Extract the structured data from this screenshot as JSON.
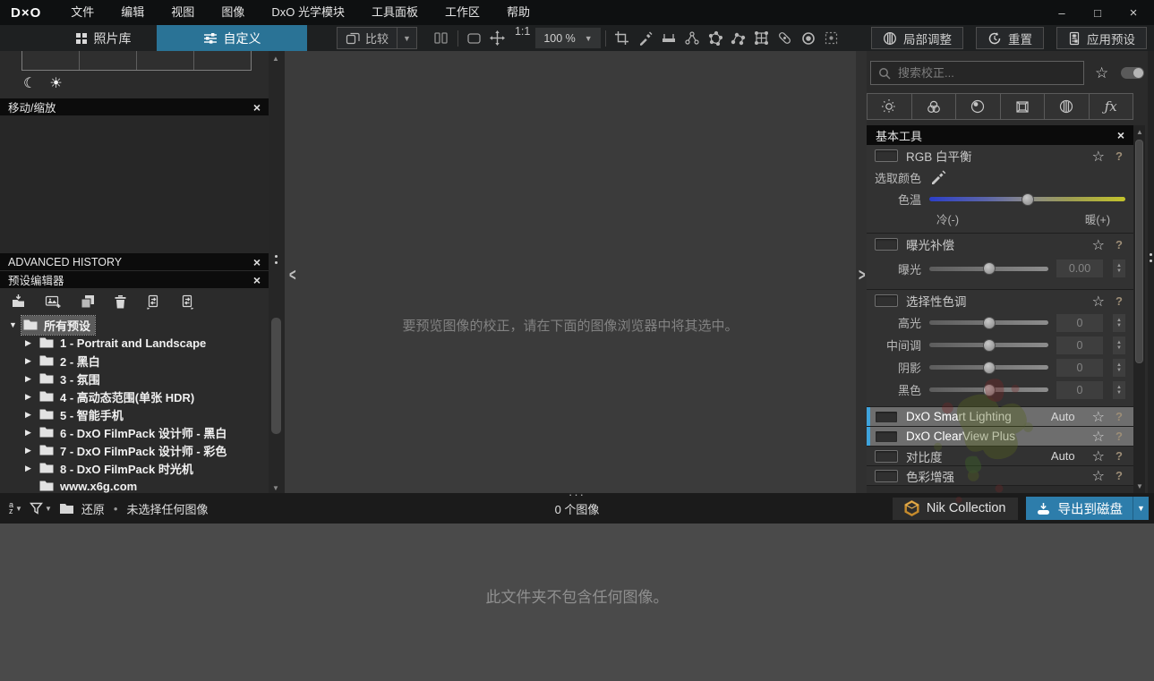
{
  "menubar": {
    "logo": "D×O",
    "items": [
      {
        "label": "文件"
      },
      {
        "label": "编辑"
      },
      {
        "label": "视图"
      },
      {
        "label": "图像"
      },
      {
        "label": "DxO 光学模块"
      },
      {
        "label": "工具面板"
      },
      {
        "label": "工作区"
      },
      {
        "label": "帮助"
      }
    ],
    "window_controls": {
      "minimize": "–",
      "maximize": "□",
      "close": "×"
    }
  },
  "toolbar": {
    "tab_photolibrary": "照片库",
    "tab_customize": "自定义",
    "compare": "比较",
    "zoom_ratio": "1:1",
    "zoom_level": "100 %",
    "local_adjustments": "局部调整",
    "reset": "重置",
    "apply_preset": "应用预设"
  },
  "left_panel": {
    "move_zoom_title": "移动/缩放",
    "history_title": "ADVANCED HISTORY",
    "preset_editor_title": "预设编辑器",
    "close_glyph": "×",
    "preset_tree": [
      {
        "arrow": "▼",
        "label": "所有预设",
        "selected": true,
        "indent": 0
      },
      {
        "arrow": "▶",
        "label": "1 - Portrait and Landscape",
        "indent": 1
      },
      {
        "arrow": "▶",
        "label": "2 - 黑白",
        "indent": 1
      },
      {
        "arrow": "▶",
        "label": "3 - 氛围",
        "indent": 1
      },
      {
        "arrow": "▶",
        "label": "4 - 高动态范围(单张 HDR)",
        "indent": 1
      },
      {
        "arrow": "▶",
        "label": "5 - 智能手机",
        "indent": 1
      },
      {
        "arrow": "▶",
        "label": "6 - DxO FilmPack 设计师 - 黑白",
        "indent": 1
      },
      {
        "arrow": "▶",
        "label": "7 - DxO FilmPack 设计师 - 彩色",
        "indent": 1
      },
      {
        "arrow": "▶",
        "label": "8 - DxO FilmPack 时光机",
        "indent": 1
      },
      {
        "arrow": "",
        "label": "www.x6g.com",
        "indent": 1
      }
    ]
  },
  "viewer": {
    "empty_message": "要预览图像的校正，请在下面的图像浏览器中将其选中。"
  },
  "right_panel": {
    "search_placeholder": "搜索校正...",
    "palette_title": "基本工具",
    "close_glyph": "×",
    "star_glyph": "☆",
    "help_glyph": "?",
    "white_balance": {
      "title": "RGB 白平衡",
      "pick_color_label": "选取颜色",
      "temp_label": "色温",
      "cold_label": "冷(-)",
      "warm_label": "暖(+)"
    },
    "exposure": {
      "title": "曝光补偿",
      "slider_label": "曝光",
      "value": "0.00"
    },
    "selective_tone": {
      "title": "选择性色调",
      "sliders": [
        {
          "label": "高光",
          "value": "0"
        },
        {
          "label": "中间调",
          "value": "0"
        },
        {
          "label": "阴影",
          "value": "0"
        },
        {
          "label": "黑色",
          "value": "0"
        }
      ]
    },
    "collapsed_sections": [
      {
        "label": "DxO Smart Lighting",
        "badge": "Auto",
        "highlighted": true
      },
      {
        "label": "DxO ClearView Plus",
        "badge": "",
        "highlighted": true
      },
      {
        "label": "对比度",
        "badge": "Auto",
        "highlighted": false
      },
      {
        "label": "色彩增强",
        "badge": "",
        "highlighted": false
      }
    ]
  },
  "statusbar": {
    "restore_label": "还原",
    "separator": "•",
    "selection_status": "未选择任何图像",
    "image_count": "0 个图像",
    "nik_button": "Nik Collection",
    "export_button": "导出到磁盘",
    "handle_glyph": "···"
  },
  "browser": {
    "empty_message": "此文件夹不包含任何图像。"
  },
  "colors": {
    "accent_tab_blue": "#2a7396",
    "export_blue": "#2d7dab",
    "highlight_bar_blue": "#3fa3dc",
    "temp_gradient_left": "#2c3fc9",
    "temp_gradient_right": "#c3c32b"
  }
}
